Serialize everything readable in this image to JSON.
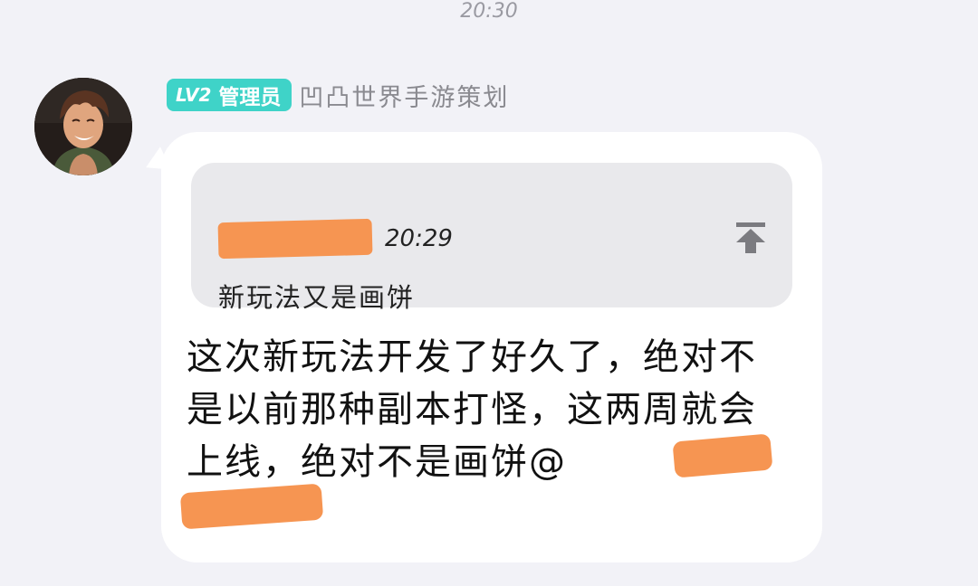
{
  "status": {
    "time": "20:30"
  },
  "sender": {
    "badge_level": "LV2",
    "badge_role": "管理员",
    "name": "凹凸世界手游策划",
    "badge_color": "#3fd3c8"
  },
  "quote": {
    "time": "20:29",
    "text": "新玩法又是画饼",
    "icon": "pin-top-icon"
  },
  "message": {
    "text": "这次新玩法开发了好久了，绝对不是以前那种副本打怪，这两周就会上线，绝对不是画饼@"
  },
  "colors": {
    "background": "#f2f2f7",
    "bubble": "#ffffff",
    "quote_background": "#e9e9ec",
    "redaction": "#f6914b"
  }
}
